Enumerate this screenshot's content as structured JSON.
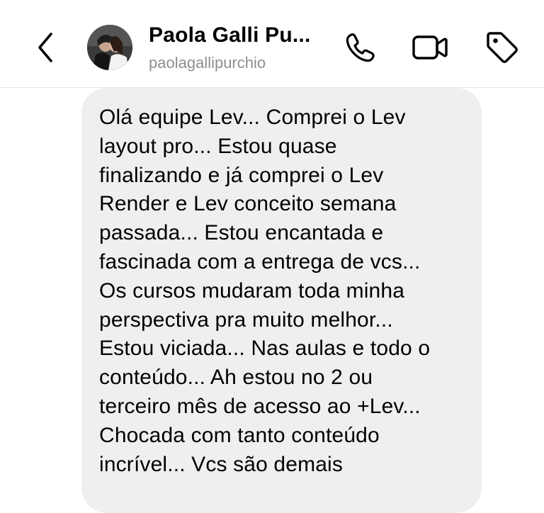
{
  "header": {
    "contact_name": "Paola Galli Pu...",
    "username": "paolagallipurchio",
    "icons": {
      "back": "chevron-left-icon",
      "call": "phone-icon",
      "video": "video-camera-icon",
      "tag": "tag-icon"
    }
  },
  "message": {
    "text": "Olá equipe Lev... Comprei o Lev\nlayout pro... Estou quase\nfinalizando e já comprei o Lev\nRender e Lev conceito semana\npassada... Estou encantada e\nfascinada com a entrega de vcs...\nOs cursos mudaram toda minha\nperspectiva pra muito melhor...\nEstou viciada... Nas aulas e todo o\nconteúdo... Ah estou no 2 ou\nterceiro mês de acesso ao +Lev...\nChocada com tanto conteúdo\nincrível... Vcs são demais"
  },
  "colors": {
    "bubble_bg": "#efefef",
    "username_gray": "#8e8e8e",
    "divider": "#e6e6e6"
  }
}
